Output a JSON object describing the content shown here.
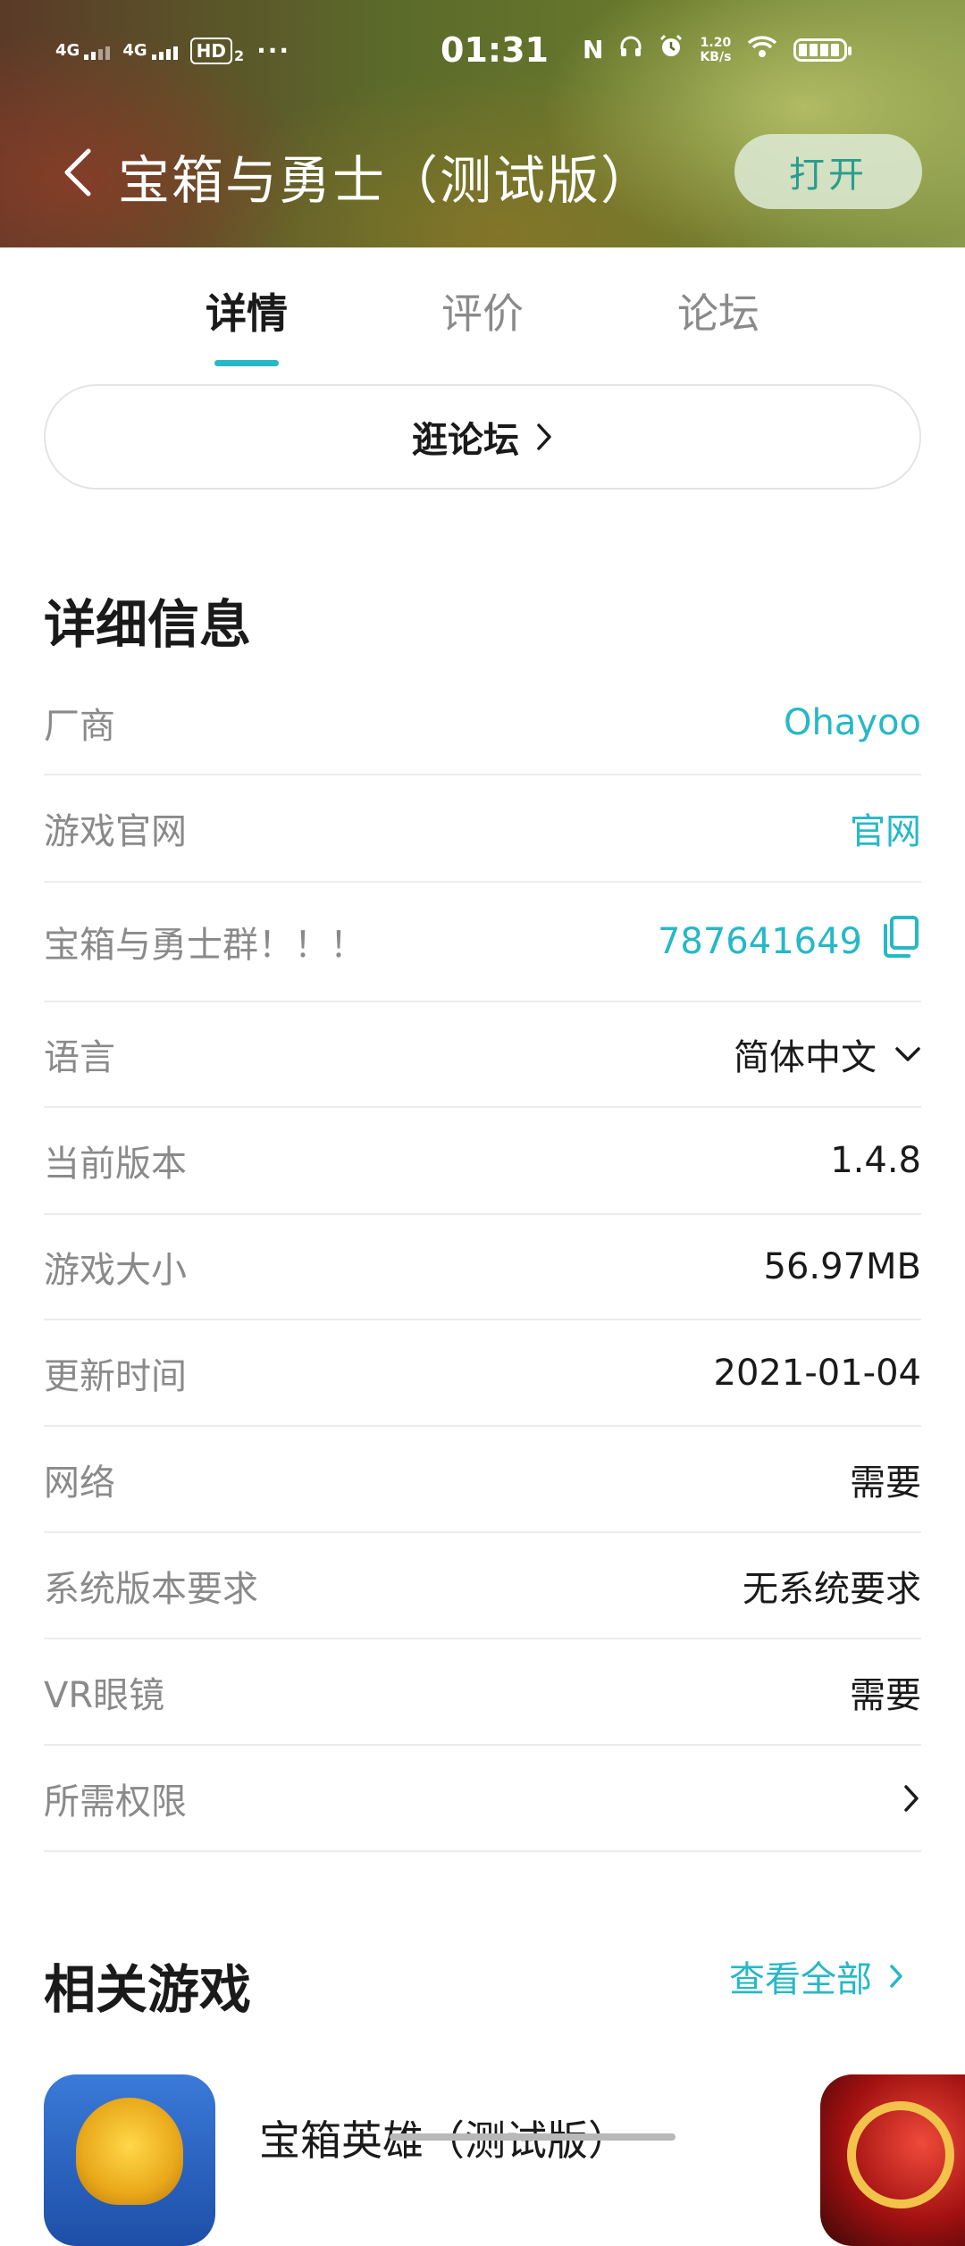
{
  "status_bar": {
    "network_1": "4G",
    "network_2": "4G",
    "hd_label": "HD",
    "hd_sub": "2",
    "more": "···",
    "time": "01:31",
    "net_speed_value": "1.20",
    "net_speed_unit": "KB/s",
    "nfc_glyph": "N"
  },
  "header": {
    "title": "宝箱与勇士（测试版）",
    "open_label": "打开",
    "background_colors": [
      "#5a3a28",
      "#5b6a2a",
      "#8a9a4a"
    ]
  },
  "tabs": [
    {
      "label": "详情",
      "active": true
    },
    {
      "label": "评价",
      "active": false
    },
    {
      "label": "论坛",
      "active": false
    }
  ],
  "forum_button": {
    "label": "逛论坛"
  },
  "details": {
    "title": "详细信息",
    "rows": [
      {
        "label": "厂商",
        "value": "Ohayoo"
      },
      {
        "label": "游戏官网",
        "value": "官网"
      },
      {
        "label": "宝箱与勇士群！！！",
        "value": "787641649"
      },
      {
        "label": "语言",
        "value": "简体中文"
      },
      {
        "label": "当前版本",
        "value": "1.4.8"
      },
      {
        "label": "游戏大小",
        "value": "56.97MB"
      },
      {
        "label": "更新时间",
        "value": "2021-01-04"
      },
      {
        "label": "网络",
        "value": "需要"
      },
      {
        "label": "系统版本要求",
        "value": "无系统要求"
      },
      {
        "label": "VR眼镜",
        "value": "需要"
      },
      {
        "label": "所需权限",
        "value": ""
      }
    ]
  },
  "related": {
    "title": "相关游戏",
    "view_all": "查看全部",
    "games": [
      {
        "title": "宝箱英雄（测试版）"
      }
    ]
  },
  "colors": {
    "accent": "#26b8c6",
    "divider": "#ececec",
    "label_gray": "#8a8a8a",
    "text": "#1a1a1a"
  }
}
